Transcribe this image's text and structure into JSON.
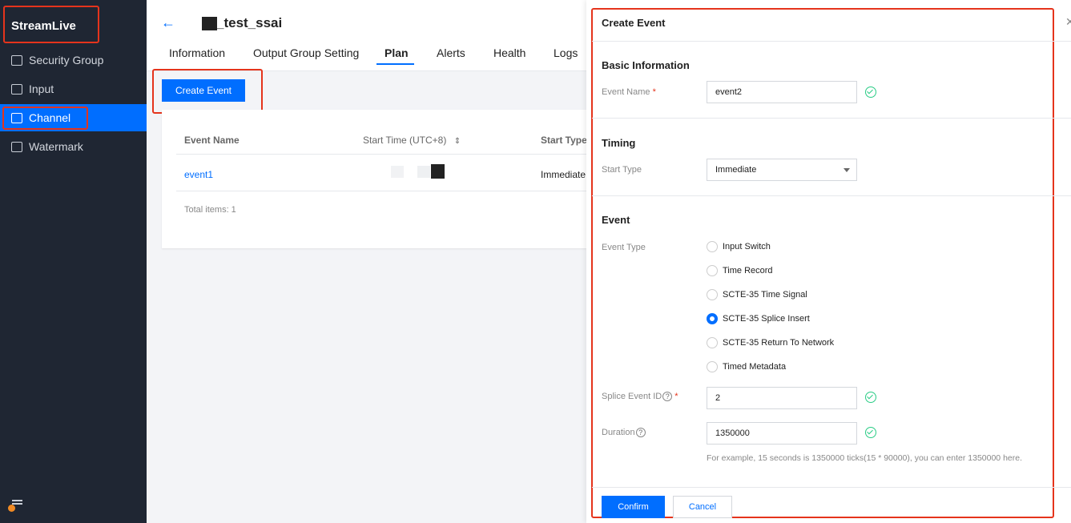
{
  "sidebar": {
    "brand": "StreamLive",
    "items": [
      {
        "label": "Security Group",
        "icon": "shield-icon"
      },
      {
        "label": "Input",
        "icon": "input-icon"
      },
      {
        "label": "Channel",
        "icon": "channel-icon"
      },
      {
        "label": "Watermark",
        "icon": "watermark-icon"
      }
    ],
    "active": "Channel",
    "active_color": "#006eff"
  },
  "header": {
    "title": "_test_ssai",
    "back_icon": "arrow-left-icon",
    "tabs": [
      "Information",
      "Output Group Setting",
      "Plan",
      "Alerts",
      "Health",
      "Logs"
    ],
    "active_tab": "Plan"
  },
  "plan": {
    "create_button": "Create Event",
    "table": {
      "columns": [
        "Event Name",
        "Start Time (UTC+8)",
        "Start Type"
      ],
      "sort_icon": "sort-icon",
      "rows": [
        {
          "event_name": "event1",
          "start_type": "Immediate"
        }
      ]
    },
    "total": "Total items:  1"
  },
  "drawer": {
    "title": "Create Event",
    "close_icon": "close-icon",
    "basic": {
      "heading": "Basic Information",
      "event_name_label": "Event Name",
      "event_name_value": "event2"
    },
    "timing": {
      "heading": "Timing",
      "start_type_label": "Start Type",
      "start_type_value": "Immediate"
    },
    "event": {
      "heading": "Event",
      "type_label": "Event Type",
      "types": [
        "Input Switch",
        "Time Record",
        "SCTE-35 Time Signal",
        "SCTE-35 Splice Insert",
        "SCTE-35 Return To Network",
        "Timed Metadata"
      ],
      "selected_type": "SCTE-35 Splice Insert",
      "splice_label": "Splice Event ID",
      "splice_value": "2",
      "duration_label": "Duration",
      "duration_value": "1350000",
      "hint": "For example, 15 seconds is 1350000 ticks(15 * 90000), you can enter 1350000 here."
    },
    "confirm": "Confirm",
    "cancel": "Cancel"
  },
  "colors": {
    "primary": "#006eff",
    "highlight_border": "#e5341c",
    "success": "#29cc85",
    "sidebar_bg": "#1f2633"
  }
}
